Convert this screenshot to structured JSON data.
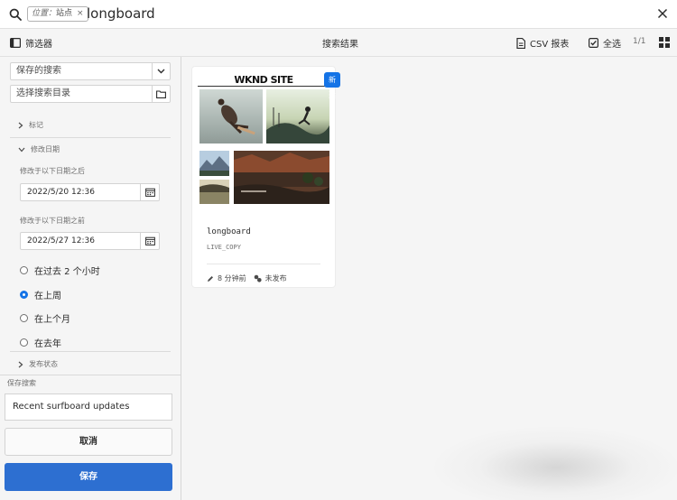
{
  "search": {
    "location_label": "位置：",
    "location_value": "站点",
    "chip_close": "×",
    "query": "longboard"
  },
  "toolbar": {
    "filters_label": "筛选器",
    "title": "搜索结果",
    "csv_label": "CSV 报表",
    "select_all_label": "全选",
    "pager": "1/1"
  },
  "sidebar": {
    "saved_search_placeholder": "保存的搜索",
    "select_dir_placeholder": "选择搜索目录",
    "tags_label": "标记",
    "modified_label": "修改日期",
    "after_label": "修改于以下日期之后",
    "after_value": "2022/5/20 12:36",
    "before_label": "修改于以下日期之前",
    "before_value": "2022/5/27 12:36",
    "radios": [
      {
        "label": "在过去 2 个小时",
        "checked": false
      },
      {
        "label": "在上周",
        "checked": true
      },
      {
        "label": "在上个月",
        "checked": false
      },
      {
        "label": "在去年",
        "checked": false
      }
    ],
    "publish_label": "发布状态",
    "save_search_label": "保存搜索",
    "save_name_value": "Recent surfboard updates",
    "cancel_label": "取消",
    "save_label": "保存"
  },
  "card": {
    "site_title": "WKND SITE",
    "badge": "新建",
    "title": "longboard",
    "subtitle": "LIVE_COPY",
    "modified": "8 分钟前",
    "status": "未发布"
  },
  "colors": {
    "accent": "#1473e6",
    "primary_button": "#2d6fd1",
    "panel_bg": "#f5f5f5"
  }
}
